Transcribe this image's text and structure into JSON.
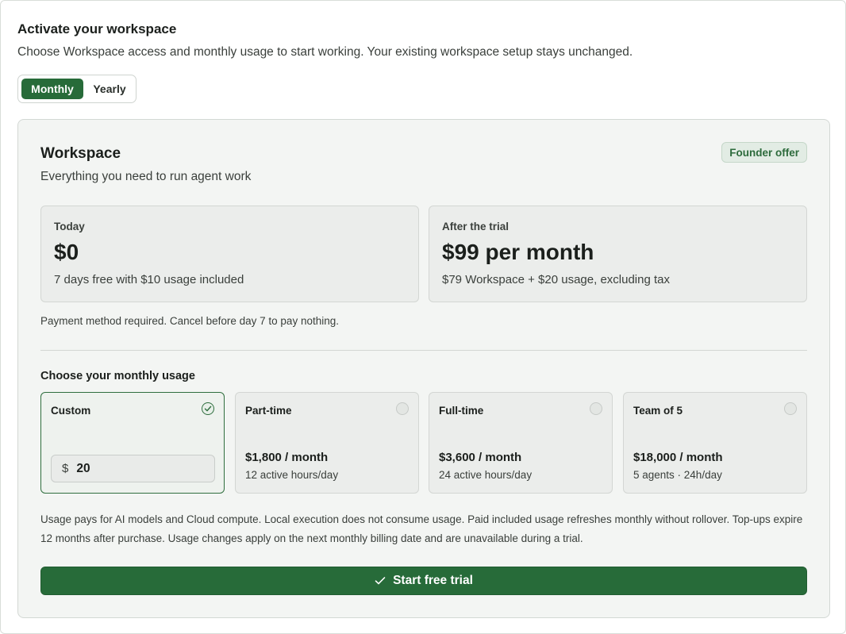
{
  "header": {
    "title": "Activate your workspace",
    "subtitle": "Choose Workspace access and monthly usage to start working. Your existing workspace setup stays unchanged."
  },
  "billing_toggle": {
    "options": [
      "Monthly",
      "Yearly"
    ],
    "selected": "Monthly"
  },
  "workspace": {
    "title": "Workspace",
    "subtitle": "Everything you need to run agent work",
    "badge": "Founder offer",
    "today": {
      "label": "Today",
      "amount": "$0",
      "note": "7 days free with $10 usage included"
    },
    "after_trial": {
      "label": "After the trial",
      "amount": "$99 per month",
      "note": "$79 Workspace + $20 usage, excluding tax"
    },
    "payment_note": "Payment method required. Cancel before day 7 to pay nothing."
  },
  "usage": {
    "title": "Choose your monthly usage",
    "plans": [
      {
        "name": "Custom",
        "selected": true,
        "currency": "$",
        "value": "20"
      },
      {
        "name": "Part-time",
        "selected": false,
        "price": "$1,800 / month",
        "detail": "12 active hours/day"
      },
      {
        "name": "Full-time",
        "selected": false,
        "price": "$3,600 / month",
        "detail": "24 active hours/day"
      },
      {
        "name": "Team of 5",
        "selected": false,
        "price": "$18,000 / month",
        "detail": "5 agents · 24h/day"
      }
    ],
    "disclaimer": "Usage pays for AI models and Cloud compute. Local execution does not consume usage. Paid included usage refreshes monthly without rollover. Top-ups expire 12 months after purchase. Usage changes apply on the next monthly billing date and are unavailable during a trial."
  },
  "cta": {
    "label": "Start free trial"
  },
  "colors": {
    "accent": "#276b39",
    "badge_text": "#2d6b3c",
    "badge_bg": "#e2ece4",
    "panel_bg": "#f3f5f3"
  },
  "icons": {
    "selected_check": "check-circle-icon",
    "cta": "check-icon"
  }
}
